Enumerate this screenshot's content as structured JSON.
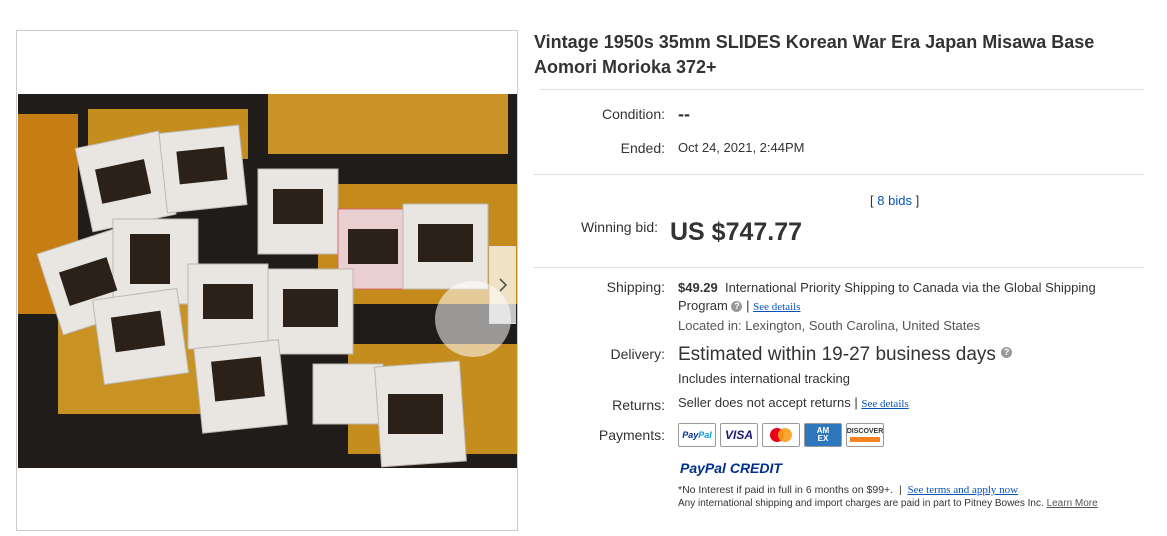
{
  "listing": {
    "title": "Vintage 1950s 35mm SLIDES Korean War Era Japan Misawa Base Aomori Morioka 372+",
    "condition_label": "Condition:",
    "condition_value": "--",
    "ended_label": "Ended:",
    "ended_value": "Oct 24, 2021, 2:44PM",
    "bids_open": "[",
    "bids_link": "8 bids",
    "bids_close": "]",
    "winning_label": "Winning bid:",
    "winning_value": "US $747.77"
  },
  "shipping": {
    "label": "Shipping:",
    "amount": "$49.29",
    "method_line1": "International Priority Shipping to Canada  via the Global Shipping",
    "method_line2": "Program",
    "separator": "|",
    "see_details": "See details",
    "located": "Located in:  Lexington, South Carolina, United States"
  },
  "delivery": {
    "label": "Delivery:",
    "estimate": "Estimated within 19-27 business days",
    "tracking": "Includes international tracking"
  },
  "returns": {
    "label": "Returns:",
    "value": "Seller does not accept returns",
    "separator": "|",
    "see_details": "See details"
  },
  "payments": {
    "label": "Payments:",
    "methods": [
      "PayPal",
      "VISA",
      "Mastercard",
      "AMEX",
      "DISCOVER"
    ],
    "paypal_credit_1": "PayPal",
    "paypal_credit_2": "CREDIT",
    "promo_text": "*No Interest if paid in full in 6 months on $99+.",
    "promo_sep": "|",
    "promo_link": "See terms and apply now",
    "pitney_text": "Any international shipping and import charges are paid in part to Pitney Bowes Inc.",
    "learn_more": "Learn More"
  },
  "icons": {
    "next": "chevron-right-icon",
    "help": "help-icon"
  },
  "colors": {
    "link": "#0654ba",
    "paypal_dark": "#003087",
    "paypal_light": "#009cde"
  }
}
